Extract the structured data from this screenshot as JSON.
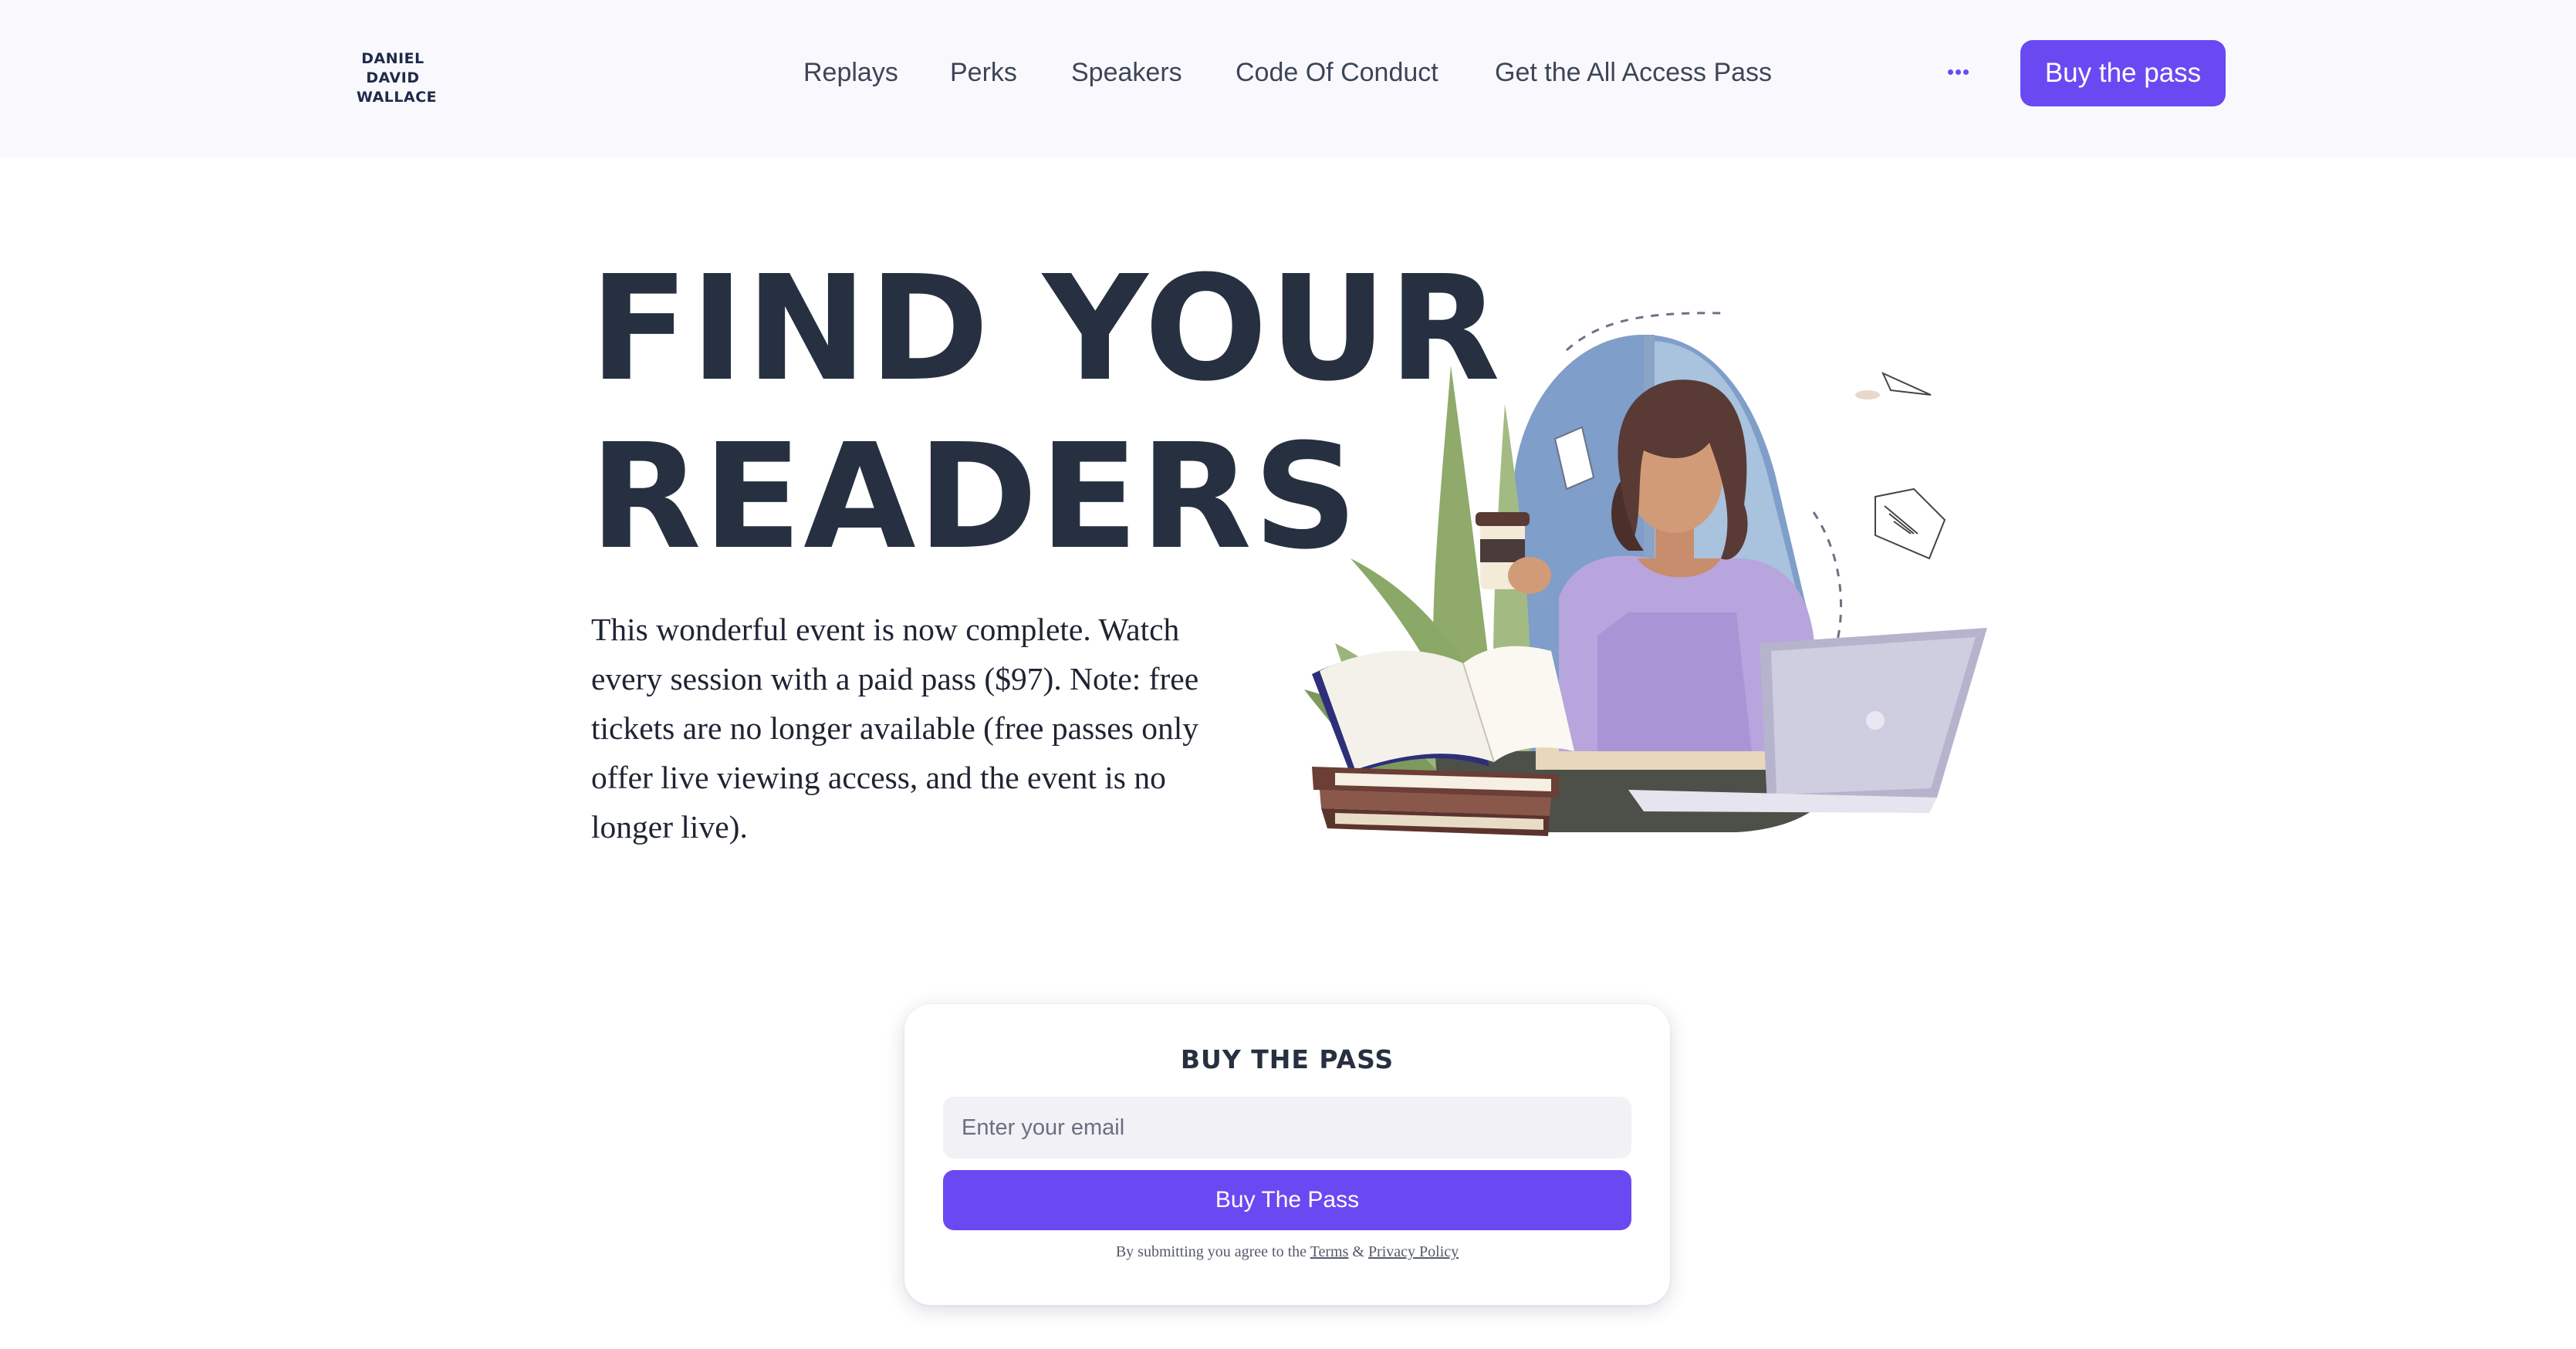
{
  "header": {
    "logo_lines": [
      "DANIEL",
      "DAVID",
      "WALLACE"
    ],
    "nav": [
      {
        "label": "Replays"
      },
      {
        "label": "Perks"
      },
      {
        "label": "Speakers"
      },
      {
        "label": "Code Of Conduct"
      },
      {
        "label": "Get the All Access Pass"
      }
    ],
    "more_icon": "more-horizontal-icon",
    "cta_label": "Buy the pass"
  },
  "hero": {
    "title_lines": [
      "FIND YOUR",
      "READERS"
    ],
    "description": "This wonderful event is now complete. Watch every session with a paid pass ($97). Note: free tickets are no longer available (free passes only offer live viewing access, and the event is no longer live).",
    "illustration": "woman-reading-with-laptop-illustration"
  },
  "signup": {
    "title": "BUY THE PASS",
    "email_placeholder": "Enter your email",
    "button_label": "Buy The Pass",
    "terms_prefix": "By submitting you agree to the",
    "terms_link": "Terms",
    "terms_amp": "&",
    "privacy_link": "Privacy Policy"
  },
  "colors": {
    "accent": "#6a49f2",
    "header_bg": "#f9f9fd",
    "heading": "#263040"
  }
}
